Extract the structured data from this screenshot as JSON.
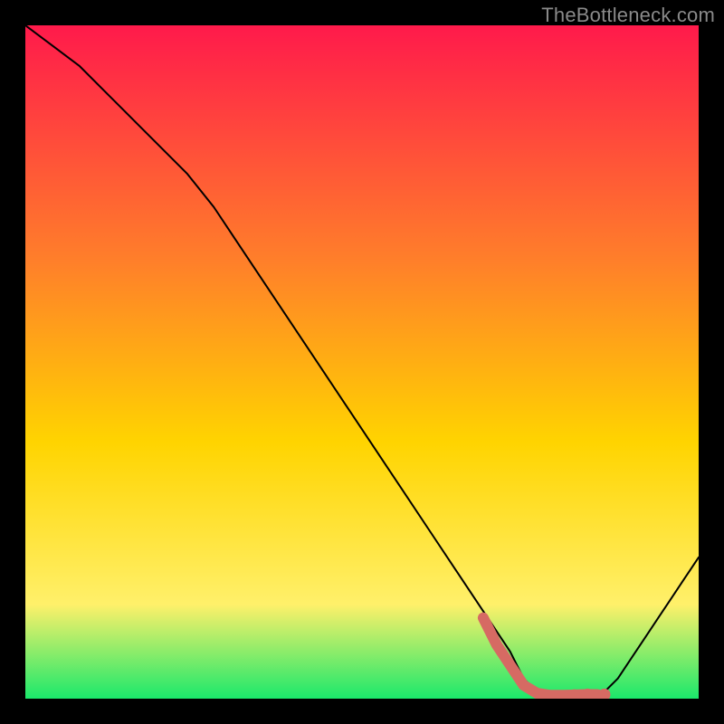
{
  "watermark": "TheBottleneck.com",
  "colors": {
    "grad_top": "#ff1a4b",
    "grad_mid1": "#ff7f2a",
    "grad_mid2": "#ffd400",
    "grad_mid3": "#fff06a",
    "grad_bottom": "#1be86b",
    "curve": "#000000",
    "marker": "#d66a63",
    "frame": "#000000"
  },
  "chart_data": {
    "type": "line",
    "title": "",
    "xlabel": "",
    "ylabel": "",
    "xlim": [
      0,
      100
    ],
    "ylim": [
      0,
      100
    ],
    "series": [
      {
        "name": "curve",
        "x": [
          0,
          4,
          8,
          12,
          16,
          20,
          24,
          28,
          32,
          36,
          40,
          44,
          48,
          52,
          56,
          60,
          64,
          68,
          72,
          74,
          76,
          78,
          80,
          82,
          84,
          86,
          88,
          90,
          92,
          94,
          96,
          98,
          100
        ],
        "y": [
          100,
          97,
          94,
          90,
          86,
          82,
          78,
          73,
          67,
          61,
          55,
          49,
          43,
          37,
          31,
          25,
          19,
          13,
          7,
          3,
          1,
          0,
          0,
          0,
          0,
          1,
          3,
          6,
          9,
          12,
          15,
          18,
          21
        ]
      },
      {
        "name": "marker",
        "x": [
          68,
          70,
          72,
          74,
          76,
          78,
          80,
          83,
          85
        ],
        "y": [
          12,
          8,
          5,
          2,
          0.8,
          0.5,
          0.5,
          0.6,
          0.6
        ]
      }
    ],
    "annotations": []
  }
}
